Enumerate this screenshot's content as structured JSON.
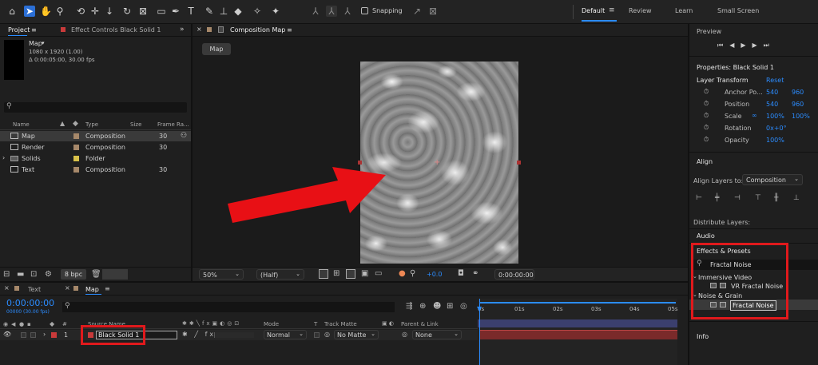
{
  "toolbar": {
    "snapping_label": "Snapping",
    "workspaces": [
      "Default",
      "Review",
      "Learn",
      "Small Screen"
    ]
  },
  "project": {
    "tab_project": "Project",
    "tab_effect_controls": "Effect Controls Black Solid 1",
    "selected_name": "Map",
    "selected_info1": "1080 x 1920 (1.00)",
    "selected_info2": "Δ 0:00:05:00, 30.00 fps",
    "search_placeholder": "",
    "columns": [
      "Name",
      "Type",
      "Size",
      "Frame Ra..."
    ],
    "items": [
      {
        "name": "Map",
        "type": "Composition",
        "size": "",
        "fps": "30",
        "color": "#a6886a"
      },
      {
        "name": "Render",
        "type": "Composition",
        "size": "",
        "fps": "30",
        "color": "#a6886a"
      },
      {
        "name": "Solids",
        "type": "Folder",
        "size": "",
        "fps": "",
        "color": "#d8c14a"
      },
      {
        "name": "Text",
        "type": "Composition",
        "size": "",
        "fps": "30",
        "color": "#a6886a"
      }
    ],
    "bpc": "8 bpc"
  },
  "composition": {
    "tab_label": "Composition Map",
    "breadcrumb": "Map",
    "zoom": "50%",
    "resolution": "(Half)",
    "exposure": "+0.0",
    "timecode": "0:00:00:00"
  },
  "right": {
    "preview_title": "Preview",
    "properties_title": "Properties: Black Solid 1",
    "layer_transform": "Layer Transform",
    "reset_label": "Reset",
    "transform": [
      {
        "label": "Anchor Po...",
        "v1": "540",
        "v2": "960"
      },
      {
        "label": "Position",
        "v1": "540",
        "v2": "960"
      },
      {
        "label": "Scale",
        "v1": "100%",
        "v2": "100%"
      },
      {
        "label": "Rotation",
        "v1": "0x+0°",
        "v2": ""
      },
      {
        "label": "Opacity",
        "v1": "100%",
        "v2": ""
      }
    ],
    "align_title": "Align",
    "align_layers_to_label": "Align Layers to:",
    "align_layers_to_value": "Composition",
    "distribute_label": "Distribute Layers:",
    "audio_title": "Audio",
    "effects_title": "Effects & Presets",
    "effects_search": "Fractal Noise",
    "categories": [
      {
        "name": "Immersive Video",
        "items": [
          "VR Fractal Noise"
        ]
      },
      {
        "name": "Noise & Grain",
        "items": [
          "Fractal Noise"
        ]
      }
    ],
    "info_title": "Info"
  },
  "timeline": {
    "tab_text": "Text",
    "tab_map": "Map",
    "timecode": "0:00:00:00",
    "timecode_sub": "00000 (30.00 fps)",
    "col_number": "#",
    "col_source": "Source Name",
    "col_mode": "Mode",
    "col_t": "T",
    "col_track_matte": "Track Matte",
    "col_parent": "Parent & Link",
    "layer": {
      "number": "1",
      "name": "Black Solid 1",
      "mode": "Normal",
      "matte": "No Matte",
      "parent": "None"
    },
    "ruler": [
      "0s",
      "01s",
      "02s",
      "03s",
      "04s",
      "05s"
    ]
  }
}
